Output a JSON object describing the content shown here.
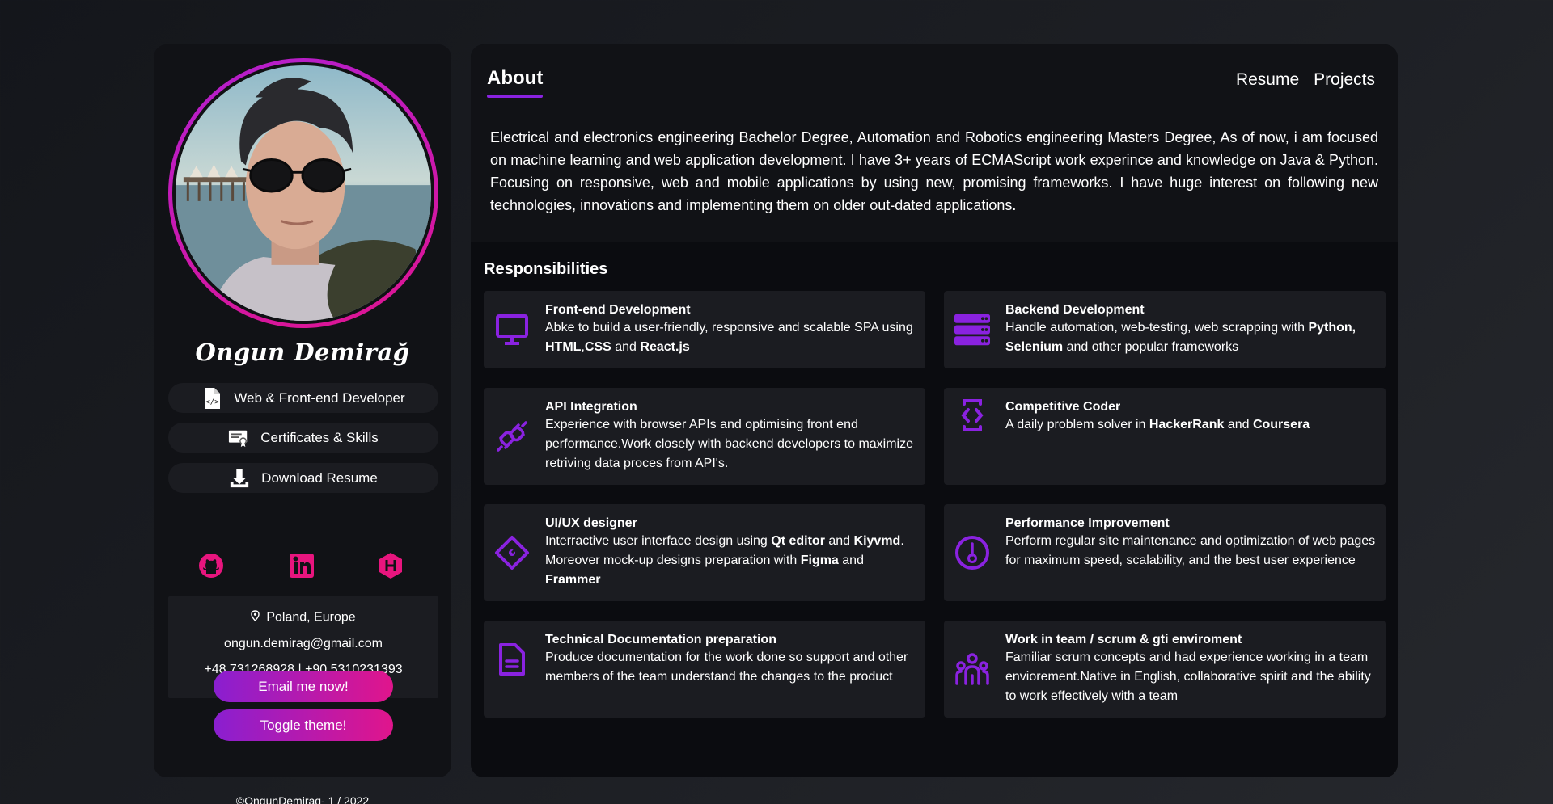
{
  "profile": {
    "name": "Ongun Demirağ",
    "buttons": [
      {
        "label": "Web & Front-end Developer",
        "icon": "code-file-icon"
      },
      {
        "label": "Certificates & Skills",
        "icon": "certificate-icon"
      },
      {
        "label": "Download Resume",
        "icon": "download-icon"
      }
    ],
    "social": [
      "github-icon",
      "linkedin-icon",
      "hackerrank-icon"
    ],
    "contact": {
      "location": "Poland, Europe",
      "email": "ongun.demirag@gmail.com",
      "phone": "+48 731268928 | +90 5310231393"
    },
    "email_button": "Email me now!",
    "theme_button": "Toggle theme!",
    "copyright": "©OngunDemirag- 1 / 2022"
  },
  "main": {
    "about_title": "About",
    "nav": [
      "Resume",
      "Projects"
    ],
    "about_text": "Electrical and electronics engineering Bachelor Degree, Automation and Robotics engineering Masters Degree, As of now, i am focused on machine learning and web application development. I have 3+ years of ECMAScript work experince and knowledge on Java & Python. Focusing on responsive, web and mobile applications by using new, promising frameworks. I have huge interest on following new technologies, innovations and implementing them on older out-dated applications.",
    "responsibilities_title": "Responsibilities",
    "cards": [
      {
        "title": "Front-end Development",
        "icon": "monitor-icon",
        "desc": [
          {
            "t": "Abke to build a user-friendly, responsive and scalable SPA using "
          },
          {
            "t": "HTML",
            "b": true
          },
          {
            "t": ","
          },
          {
            "t": "CSS",
            "b": true
          },
          {
            "t": " and "
          },
          {
            "t": "React.js",
            "b": true
          }
        ]
      },
      {
        "title": "Backend Development",
        "icon": "server-icon",
        "desc": [
          {
            "t": "Handle automation, web-testing, web scrapping with "
          },
          {
            "t": "Python, Selenium",
            "b": true
          },
          {
            "t": " and other popular frameworks"
          }
        ]
      },
      {
        "title": "API Integration",
        "icon": "plug-icon",
        "desc": [
          {
            "t": "Experience with browser APIs and optimising front end performance.Work closely with backend developers to maximize retriving data proces from API's."
          }
        ]
      },
      {
        "title": "Competitive Coder",
        "icon": "code-device-icon",
        "desc": [
          {
            "t": "A daily problem solver in "
          },
          {
            "t": "HackerRank",
            "b": true
          },
          {
            "t": " and "
          },
          {
            "t": "Coursera",
            "b": true
          }
        ]
      },
      {
        "title": "UI/UX designer",
        "icon": "design-diamond-icon",
        "desc": [
          {
            "t": "Interractive user interface design using "
          },
          {
            "t": "Qt editor",
            "b": true
          },
          {
            "t": " and "
          },
          {
            "t": "Kiyvmd",
            "b": true
          },
          {
            "t": ". Moreover mock-up designs preparation with "
          },
          {
            "t": "Figma",
            "b": true
          },
          {
            "t": " and "
          },
          {
            "t": "Frammer",
            "b": true
          }
        ]
      },
      {
        "title": "Performance Improvement",
        "icon": "speedometer-icon",
        "desc": [
          {
            "t": "Perform regular site maintenance and optimization of web pages for maximum speed, scalability, and the best user experience"
          }
        ]
      },
      {
        "title": "Technical Documentation preparation",
        "icon": "document-icon",
        "desc": [
          {
            "t": "Produce documentation for the work done so support and other members of the team understand the changes to the product"
          }
        ]
      },
      {
        "title": "Work in team / scrum & gti enviroment",
        "icon": "team-icon",
        "desc": [
          {
            "t": "Familiar scrum concepts and had experience working in a team enviorement.Native in English, collaborative spirit and the ability to work effectively with a team"
          }
        ]
      }
    ]
  },
  "colors": {
    "accent_purple": "#8a22e0",
    "accent_pink": "#e0158c",
    "card_bg": "#1b1c21",
    "panel_bg": "#111216"
  }
}
